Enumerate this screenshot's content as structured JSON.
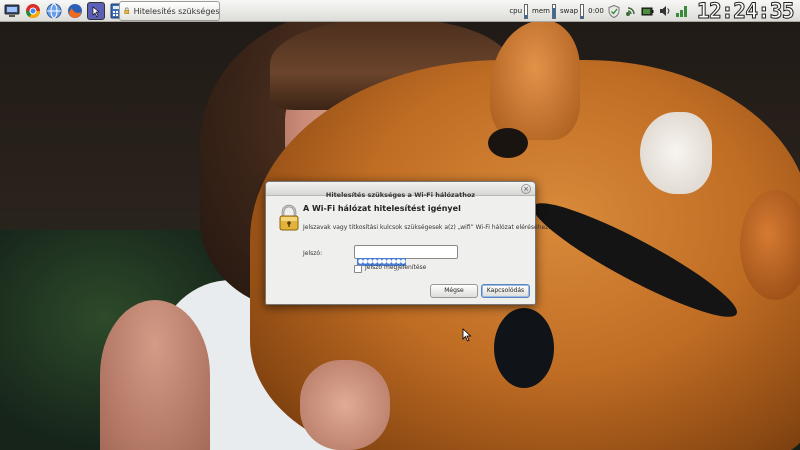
{
  "panel": {
    "taskbar_window_title": "Hitelesítés szükséges a Wi-Fi...",
    "system_monitor": {
      "cpu_label": "cpu",
      "mem_label": "mem",
      "swap_label": "swap",
      "cpu_level": 0.2,
      "mem_level": 0.7,
      "swap_level": 0.1
    },
    "small_time": "0:00",
    "clock": "12:24:35",
    "launcher_icons": [
      "computer-icon",
      "chrome-icon",
      "web-browser-icon",
      "firefox-icon",
      "terminal-icon",
      "calculator-icon"
    ],
    "tray_icons": [
      "shield-check-icon",
      "network-icon",
      "battery-icon",
      "volume-icon",
      "update-icon"
    ]
  },
  "dialog": {
    "title": "Hitelesítés szükséges a Wi-Fi hálózathoz",
    "close_glyph": "×",
    "heading": "A Wi-Fi hálózat hitelesítést igényel",
    "message": "Jelszavak vagy titkosítási kulcsok szükségesek a(z) „wifi” Wi-Fi hálózat eléréséhez.",
    "password_label": "Jelszó:",
    "password_mask": "●●●●●●●●●●",
    "show_password_label": "Jelszó megjelenítése",
    "show_password_checked": false,
    "cancel_label": "Mégse",
    "connect_label": "Kapcsolódás"
  },
  "colors": {
    "accent": "#4a7ed6",
    "panel_bg": "#dcdcd8",
    "dialog_bg": "#efefed"
  }
}
